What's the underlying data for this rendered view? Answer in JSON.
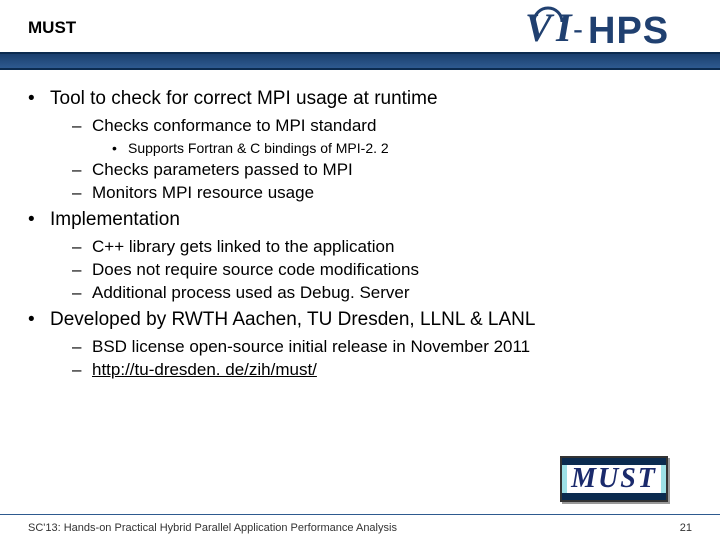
{
  "header": {
    "title": "MUST",
    "logo_text_1": "VI",
    "logo_text_2": "HPS"
  },
  "bullets": [
    {
      "text": "Tool to check for correct MPI usage at runtime",
      "children": [
        {
          "text": "Checks conformance to MPI standard",
          "children": [
            {
              "text": "Supports Fortran & C bindings of MPI-2. 2"
            }
          ]
        },
        {
          "text": "Checks parameters passed to MPI"
        },
        {
          "text": "Monitors MPI resource usage"
        }
      ]
    },
    {
      "text": "Implementation",
      "children": [
        {
          "text": "C++ library gets linked to the application"
        },
        {
          "text": "Does not require source code modifications"
        },
        {
          "text": "Additional process used as Debug. Server"
        }
      ]
    },
    {
      "text": "Developed by RWTH Aachen, TU Dresden, LLNL & LANL",
      "children": [
        {
          "text": "BSD license open-source initial release in November 2011"
        },
        {
          "text": "http://tu-dresden. de/zih/must/",
          "link": true
        }
      ]
    }
  ],
  "must_logo_text": "MUST",
  "footer": {
    "left": "SC'13: Hands-on Practical Hybrid Parallel Application Performance Analysis",
    "page": "21"
  }
}
